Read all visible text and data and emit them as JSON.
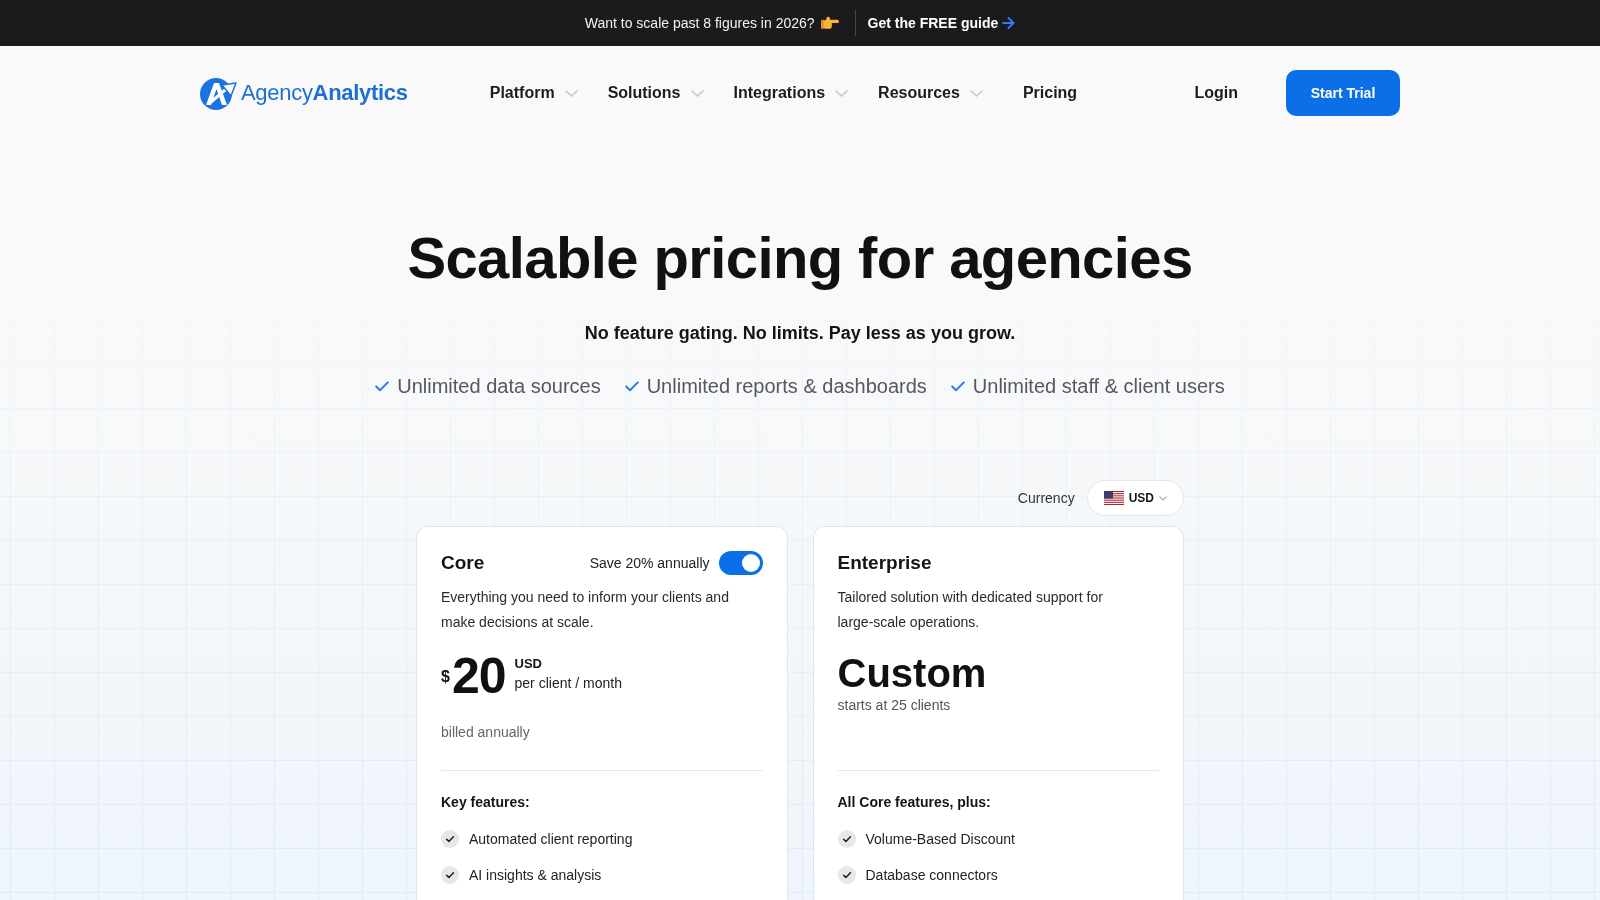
{
  "announcement": {
    "text": "Want to scale past 8 figures in 2026?",
    "link": "Get the FREE guide"
  },
  "header": {
    "logo": "Agency**Analytics**",
    "nav": [
      {
        "label": "Platform",
        "dropdown": true
      },
      {
        "label": "Solutions",
        "dropdown": true
      },
      {
        "label": "Integrations",
        "dropdown": true
      },
      {
        "label": "Resources",
        "dropdown": true
      },
      {
        "label": "Pricing",
        "dropdown": false
      }
    ],
    "login": "Login",
    "cta": "Start Trial"
  },
  "hero": {
    "title": "Scalable pricing for agencies",
    "subtitle": "No feature gating. No limits. Pay less as you grow.",
    "highlights": [
      "Unlimited data sources",
      "Unlimited reports & dashboards",
      "Unlimited staff & client users"
    ]
  },
  "currency": {
    "label": "Currency",
    "value": "USD"
  },
  "plans": [
    {
      "kind": "price",
      "name": "Core",
      "toggle": {
        "label": "Save 20% annually",
        "on": true
      },
      "description": "Everything you need to inform your clients and make decisions at scale.",
      "symbol": "$",
      "amount": "20",
      "unit": "USD",
      "period": "per client / month",
      "note": "billed annually",
      "features_title": "Key features:",
      "features": [
        "Automated client reporting",
        "AI insights & analysis"
      ]
    },
    {
      "kind": "custom",
      "name": "Enterprise",
      "description": "Tailored solution with dedicated support for large-scale operations.",
      "amount": "Custom",
      "note": "starts at 25 clients",
      "features_title": "All Core features, plus:",
      "features": [
        "Volume-Based Discount",
        "Database connectors"
      ]
    }
  ]
}
